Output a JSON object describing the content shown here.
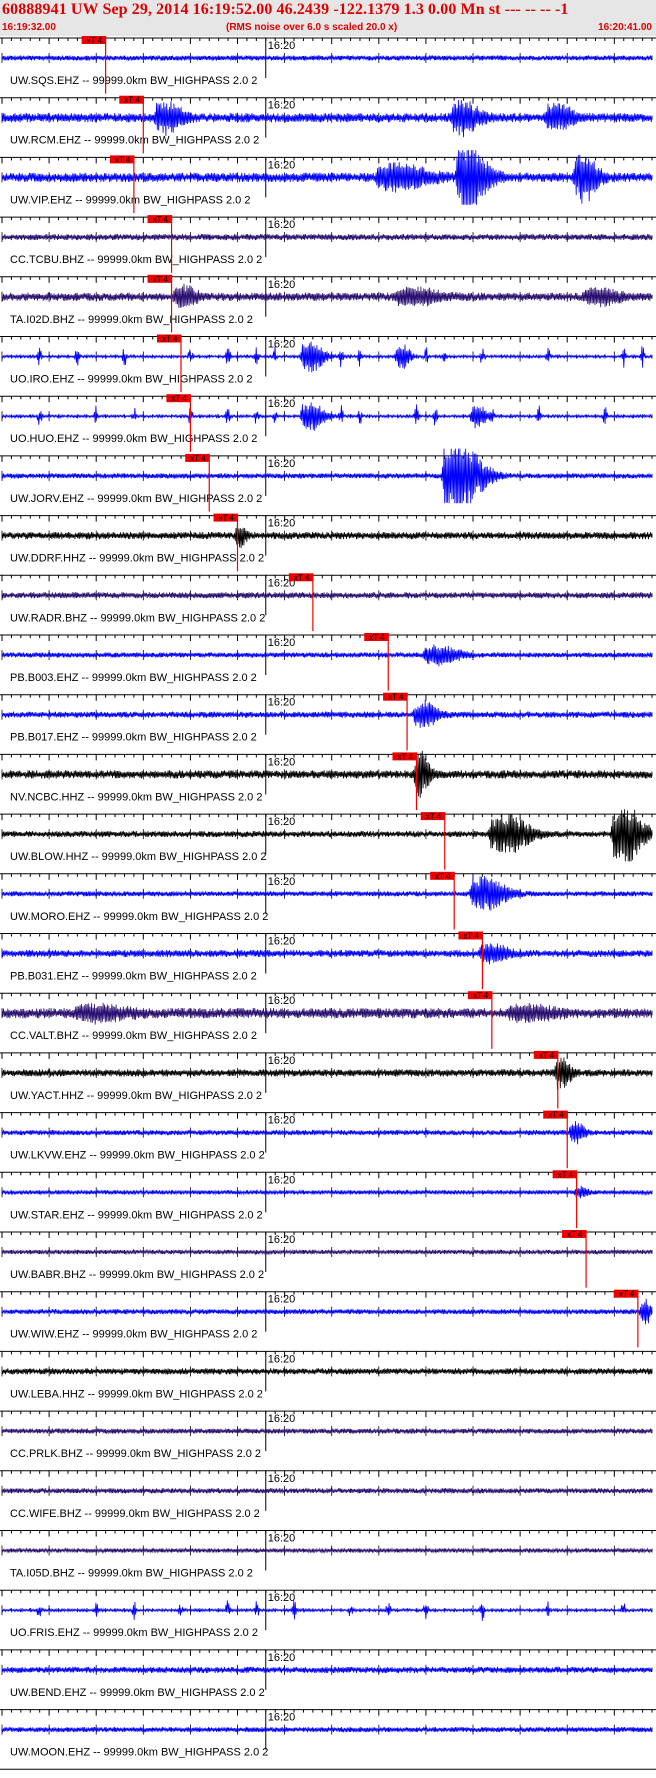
{
  "header": {
    "title": "60888941 UW Sep 29, 2014 16:19:52.00   46.2439 -122.1379  1.3 0.00 Mn st --- -- --  -1",
    "start_time": "16:19:32.00",
    "note": "(RMS noise over 6.0 s scaled 20.0 x)",
    "end_time": "16:20:41.00"
  },
  "chart_data": {
    "type": "line",
    "title": "60888941 UW Sep 29, 2014 16:19:52.00   46.2439 -122.1379  1.3 0.00 Mn st --- -- --  -1",
    "x_start": "16:19:32.00",
    "x_end": "16:20:41.00",
    "x_range_seconds": [
      0,
      69
    ],
    "minute_mark": {
      "label": "16:20",
      "t": 28
    },
    "tick_major_seconds": 5,
    "tick_minor_seconds": 1,
    "pick_label": "xT 4",
    "colors": {
      "blue": "#0000ff",
      "purple": "#2a1070",
      "black": "#000000",
      "pick": "#ee0000"
    },
    "series": [
      {
        "name": "UW.SQS.EHZ -- 99999.0km BW_HIGHPASS  2.0  2",
        "color": "blue",
        "pick_t": 11.0,
        "amp": 0.1,
        "bursts": [],
        "spikes": []
      },
      {
        "name": "UW.RCM.EHZ -- 99999.0km BW_HIGHPASS  2.0  2",
        "color": "blue",
        "pick_t": 15.0,
        "amp": 0.18,
        "bursts": [
          [
            16.5,
            3,
            0.55
          ],
          [
            48,
            3,
            0.6
          ],
          [
            58,
            3,
            0.45
          ]
        ],
        "spikes": []
      },
      {
        "name": "UW.VIP.EHZ -- 99999.0km BW_HIGHPASS  2.0  2",
        "color": "blue",
        "pick_t": 14.0,
        "amp": 0.18,
        "bursts": [
          [
            40,
            6,
            0.45
          ],
          [
            48.5,
            3.5,
            1.3
          ],
          [
            61,
            2.5,
            0.95
          ]
        ],
        "spikes": []
      },
      {
        "name": "CC.TCBU.BHZ -- 99999.0km BW_HIGHPASS  2.0  2",
        "color": "purple",
        "pick_t": 18.0,
        "amp": 0.12,
        "bursts": [],
        "spikes": []
      },
      {
        "name": "TA.I02D.BHZ -- 99999.0km BW_HIGHPASS  2.0  2",
        "color": "purple",
        "pick_t": 18.0,
        "amp": 0.16,
        "bursts": [
          [
            18.5,
            2.5,
            0.4
          ],
          [
            42,
            5,
            0.3
          ],
          [
            62,
            4,
            0.3
          ]
        ],
        "spikes": []
      },
      {
        "name": "UO.IRO.EHZ -- 99999.0km BW_HIGHPASS  2.0  2",
        "color": "blue",
        "pick_t": 19.0,
        "amp": 0.05,
        "bursts": [
          [
            32,
            2.5,
            0.6
          ],
          [
            42,
            1.5,
            0.5
          ]
        ],
        "spikes": [
          4,
          8,
          13,
          20,
          24,
          27,
          29,
          36,
          38,
          45,
          47,
          51,
          58,
          66,
          68
        ]
      },
      {
        "name": "UO.HUO.EHZ -- 99999.0km BW_HIGHPASS  2.0  2",
        "color": "blue",
        "pick_t": 20.0,
        "amp": 0.05,
        "bursts": [
          [
            32,
            2.5,
            0.6
          ],
          [
            50,
            1.5,
            0.5
          ]
        ],
        "spikes": [
          4,
          10,
          14,
          20,
          24,
          27,
          29,
          36,
          38,
          44,
          46,
          52,
          57,
          64
        ]
      },
      {
        "name": "UW.JORV.EHZ -- 99999.0km BW_HIGHPASS  2.0  2",
        "color": "blue",
        "pick_t": 22.0,
        "amp": 0.1,
        "bursts": [
          [
            47,
            4.5,
            1.4
          ]
        ],
        "spikes": []
      },
      {
        "name": "UW.DDRF.HHZ -- 99999.0km BW_HIGHPASS  2.0  2",
        "color": "black",
        "pick_t": 25.0,
        "amp": 0.14,
        "bursts": [
          [
            25,
            1,
            0.4
          ]
        ],
        "spikes": []
      },
      {
        "name": "UW.RADR.BHZ -- 99999.0km BW_HIGHPASS  2.0  2",
        "color": "purple",
        "pick_t": 33.0,
        "amp": 0.12,
        "bursts": [],
        "spikes": []
      },
      {
        "name": "PB.B003.EHZ -- 99999.0km BW_HIGHPASS  2.0  2",
        "color": "blue",
        "pick_t": 41.0,
        "amp": 0.1,
        "bursts": [
          [
            45,
            4,
            0.35
          ]
        ],
        "spikes": []
      },
      {
        "name": "PB.B017.EHZ -- 99999.0km BW_HIGHPASS  2.0  2",
        "color": "blue",
        "pick_t": 43.0,
        "amp": 0.12,
        "bursts": [
          [
            44,
            2.5,
            0.5
          ]
        ],
        "spikes": []
      },
      {
        "name": "NV.NCBC.HHZ -- 99999.0km BW_HIGHPASS  2.0  2",
        "color": "black",
        "pick_t": 44.0,
        "amp": 0.16,
        "bursts": [
          [
            44,
            1.5,
            0.9
          ]
        ],
        "spikes": []
      },
      {
        "name": "UW.BLOW.HHZ -- 99999.0km BW_HIGHPASS  2.0  2",
        "color": "black",
        "pick_t": 47.0,
        "amp": 0.12,
        "bursts": [
          [
            52,
            4.5,
            0.7
          ],
          [
            65,
            3.5,
            1.1
          ]
        ],
        "spikes": []
      },
      {
        "name": "UW.MORO.EHZ -- 99999.0km BW_HIGHPASS  2.0  2",
        "color": "blue",
        "pick_t": 48.0,
        "amp": 0.1,
        "bursts": [
          [
            50,
            4,
            0.65
          ]
        ],
        "spikes": []
      },
      {
        "name": "PB.B031.EHZ -- 99999.0km BW_HIGHPASS  2.0  2",
        "color": "blue",
        "pick_t": 51.0,
        "amp": 0.14,
        "bursts": [
          [
            51,
            3,
            0.35
          ]
        ],
        "spikes": []
      },
      {
        "name": "CC.VALT.BHZ -- 99999.0km BW_HIGHPASS  2.0  2",
        "color": "purple",
        "pick_t": 52.0,
        "amp": 0.2,
        "bursts": [
          [
            8,
            6,
            0.25
          ],
          [
            54,
            5,
            0.25
          ]
        ],
        "spikes": []
      },
      {
        "name": "UW.YACT.HHZ -- 99999.0km BW_HIGHPASS  2.0  2",
        "color": "black",
        "pick_t": 59.0,
        "amp": 0.14,
        "bursts": [
          [
            59,
            1.5,
            0.6
          ]
        ],
        "spikes": []
      },
      {
        "name": "UW.LKVW.EHZ -- 99999.0km BW_HIGHPASS  2.0  2",
        "color": "blue",
        "pick_t": 60.0,
        "amp": 0.1,
        "bursts": [
          [
            60.5,
            1.5,
            0.4
          ]
        ],
        "spikes": []
      },
      {
        "name": "UW.STAR.EHZ -- 99999.0km BW_HIGHPASS  2.0  2",
        "color": "blue",
        "pick_t": 61.0,
        "amp": 0.08,
        "bursts": [
          [
            61,
            1.5,
            0.2
          ]
        ],
        "spikes": []
      },
      {
        "name": "UW.BABR.BHZ -- 99999.0km BW_HIGHPASS  2.0  2",
        "color": "purple",
        "pick_t": 62.0,
        "amp": 0.08,
        "bursts": [],
        "spikes": []
      },
      {
        "name": "UW.WIW.EHZ -- 99999.0km BW_HIGHPASS  2.0  2",
        "color": "blue",
        "pick_t": 67.5,
        "amp": 0.1,
        "bursts": [
          [
            68,
            1,
            0.5
          ]
        ],
        "spikes": []
      },
      {
        "name": "UW.LEBA.HHZ -- 99999.0km BW_HIGHPASS  2.0  2",
        "color": "black",
        "pick_t": null,
        "amp": 0.12,
        "bursts": [],
        "spikes": []
      },
      {
        "name": "CC.PRLK.BHZ -- 99999.0km BW_HIGHPASS  2.0  2",
        "color": "purple",
        "pick_t": null,
        "amp": 0.1,
        "bursts": [],
        "spikes": []
      },
      {
        "name": "CC.WIFE.BHZ -- 99999.0km BW_HIGHPASS  2.0  2",
        "color": "purple",
        "pick_t": null,
        "amp": 0.1,
        "bursts": [],
        "spikes": []
      },
      {
        "name": "TA.I05D.BHZ -- 99999.0km BW_HIGHPASS  2.0  2",
        "color": "purple",
        "pick_t": null,
        "amp": 0.08,
        "bursts": [],
        "spikes": []
      },
      {
        "name": "UO.FRIS.EHZ -- 99999.0km BW_HIGHPASS  2.0  2",
        "color": "blue",
        "pick_t": null,
        "amp": 0.05,
        "bursts": [],
        "spikes": [
          4,
          10,
          14,
          19,
          24,
          27,
          31,
          37,
          41,
          45,
          51,
          58,
          66
        ]
      },
      {
        "name": "UW.BEND.EHZ -- 99999.0km BW_HIGHPASS  2.0  2",
        "color": "blue",
        "pick_t": null,
        "amp": 0.12,
        "bursts": [],
        "spikes": []
      },
      {
        "name": "UW.MOON.EHZ -- 99999.0km BW_HIGHPASS  2.0  2",
        "color": "blue",
        "pick_t": null,
        "amp": 0.1,
        "bursts": [],
        "spikes": []
      }
    ]
  }
}
